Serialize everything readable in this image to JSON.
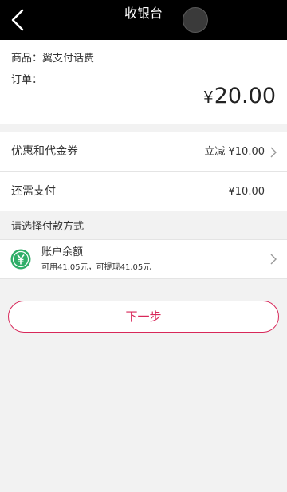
{
  "header": {
    "title": "收银台",
    "subtitle": "",
    "back_icon": "chevron-left-icon"
  },
  "order": {
    "product_line": "商品：翼支付话费",
    "order_line": "订单：",
    "amount_symbol": "¥",
    "amount": "20.00"
  },
  "discount": {
    "label": "优惠和代金券",
    "value": "立减 ¥10.00",
    "arrow_icon": "chevron-right-icon"
  },
  "remaining": {
    "label": "还需支付",
    "value": "¥10.00"
  },
  "payment": {
    "section_title": "请选择付款方式",
    "method_icon": "yen-circle-icon",
    "method_title": "账户余额",
    "method_desc": "可用41.05元，可提现41.05元",
    "arrow_icon": "chevron-right-icon"
  },
  "actions": {
    "next_label": "下一步"
  },
  "colors": {
    "accent": "#d8285a",
    "icon_green": "#2fae68",
    "header_bg": "#000000",
    "page_bg": "#f2f2f2"
  }
}
